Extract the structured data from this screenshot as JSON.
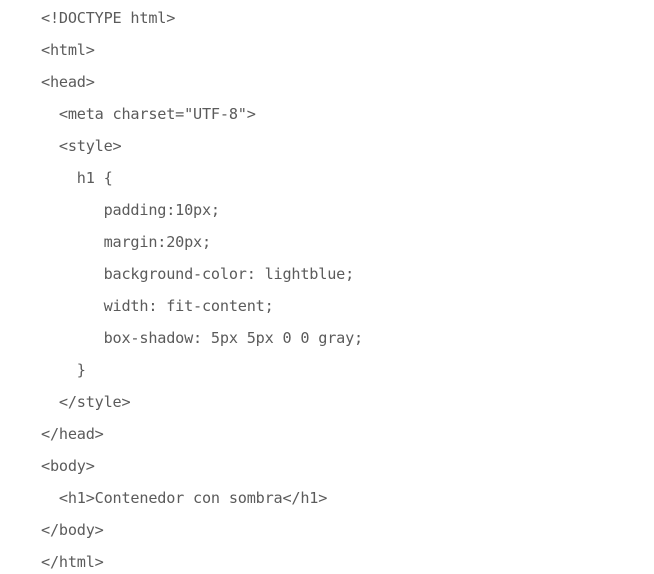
{
  "code": {
    "lines": [
      "<!DOCTYPE html>",
      "<html>",
      "<head>",
      "  <meta charset=\"UTF-8\">",
      "  <style>",
      "    h1 {",
      "       padding:10px;",
      "       margin:20px;",
      "       background-color: lightblue;",
      "       width: fit-content;",
      "       box-shadow: 5px 5px 0 0 gray;",
      "    }",
      "  </style>",
      "</head>",
      "<body>",
      "  <h1>Contenedor con sombra</h1>",
      "</body>",
      "</html>"
    ]
  }
}
